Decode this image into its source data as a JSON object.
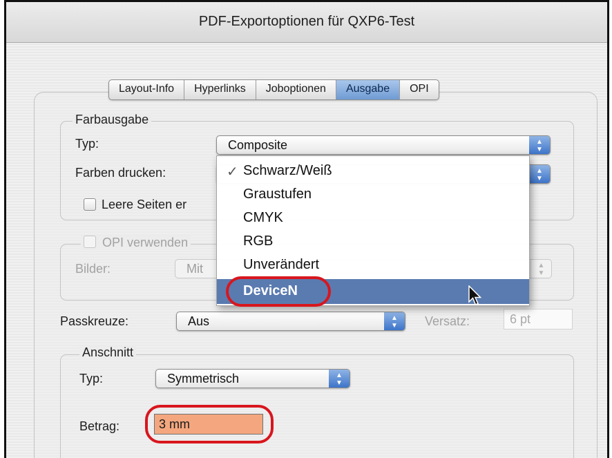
{
  "window": {
    "title": "PDF-Exportoptionen für QXP6-Test"
  },
  "tabs": [
    "Layout-Info",
    "Hyperlinks",
    "Joboptionen",
    "Ausgabe",
    "OPI"
  ],
  "active_tab": "Ausgabe",
  "farbausgabe": {
    "legend": "Farbausgabe",
    "typ_label": "Typ:",
    "typ_value": "Composite",
    "farben_label": "Farben drucken:",
    "leere_seiten_label": "Leere Seiten erzeugen",
    "leere_seiten_visible": "Leere Seiten er"
  },
  "opi": {
    "checkbox_label": "OPI verwenden",
    "bilder_label": "Bilder:",
    "bilder_value": "Mit"
  },
  "dropdown_menu": {
    "items": [
      {
        "label": "Schwarz/Weiß",
        "checked": true
      },
      {
        "label": "Graustufen"
      },
      {
        "label": "CMYK"
      },
      {
        "label": "RGB"
      },
      {
        "label": "Unverändert"
      },
      {
        "label": "DeviceN",
        "highlighted": true
      }
    ]
  },
  "passkreuze": {
    "label": "Passkreuze:",
    "value": "Aus",
    "versatz_label": "Versatz:",
    "versatz_value": "6 pt"
  },
  "anschnitt": {
    "legend": "Anschnitt",
    "typ_label": "Typ:",
    "typ_value": "Symmetrisch",
    "betrag_label": "Betrag:",
    "betrag_value": "3 mm"
  },
  "colors": {
    "highlight_ring": "#d8161d",
    "menu_selection": "#5a7bb0",
    "tab_active": "#7da3d8",
    "betrag_field": "#f4a77f"
  }
}
